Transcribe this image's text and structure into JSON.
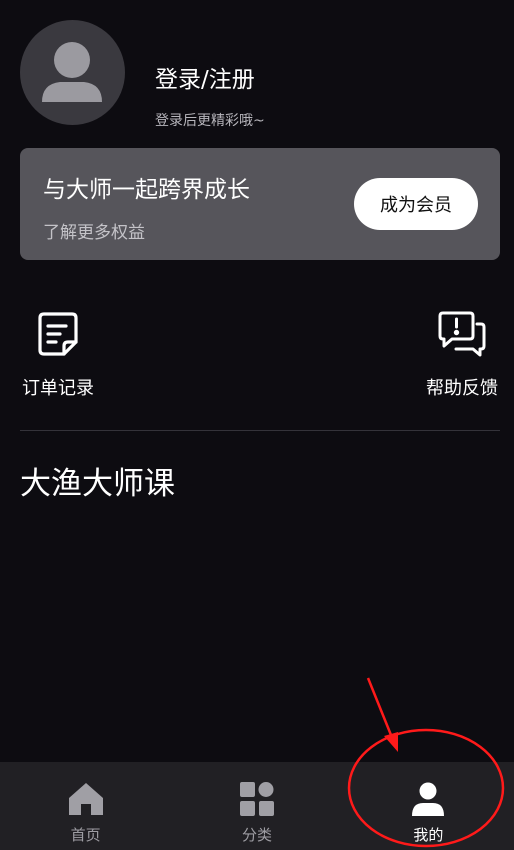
{
  "profile": {
    "login_title": "登录/注册",
    "login_subtitle": "登录后更精彩哦~",
    "avatar_icon": "user-avatar-icon"
  },
  "vip_card": {
    "title": "与大师一起跨界成长",
    "subtitle": "了解更多权益",
    "button_label": "成为会员"
  },
  "shortcuts": {
    "orders_label": "订单记录",
    "orders_icon": "order-record-icon",
    "help_label": "帮助反馈",
    "help_icon": "help-feedback-icon"
  },
  "section": {
    "title": "大渔大师课"
  },
  "tabbar": {
    "tabs": [
      {
        "label": "首页",
        "icon": "home-icon",
        "active": false
      },
      {
        "label": "分类",
        "icon": "category-icon",
        "active": false
      },
      {
        "label": "我的",
        "icon": "profile-icon",
        "active": true
      }
    ]
  },
  "colors": {
    "background": "#0d0c11",
    "card": "#56555b",
    "tabbar": "#212024",
    "annotation": "#ff1a1a"
  }
}
